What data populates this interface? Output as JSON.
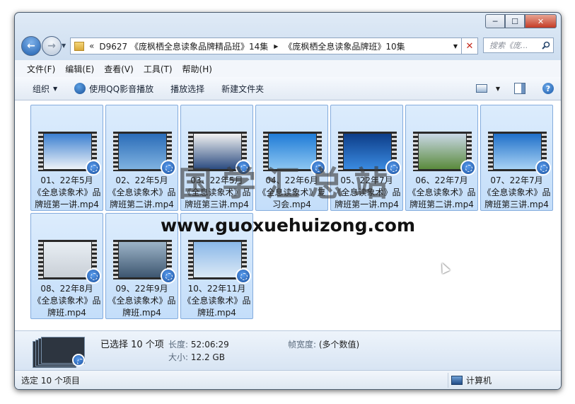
{
  "window": {
    "controls": {
      "minimize": "─",
      "maximize": "☐",
      "close": "✕"
    }
  },
  "nav": {
    "back": "←",
    "forward": "→",
    "chevron": "«",
    "path": [
      "D9627 《庞枫栖全息读象品牌精品班》14集",
      "《庞枫栖全息读象品牌班》10集"
    ],
    "search_placeholder": "搜索《庞...",
    "stop": "✕"
  },
  "menu": [
    "文件(F)",
    "编辑(E)",
    "查看(V)",
    "工具(T)",
    "帮助(H)"
  ],
  "toolbar": {
    "organize": "组织",
    "play_qq": "使用QQ影音播放",
    "play_selection": "播放选择",
    "new_folder": "新建文件夹",
    "help": "?"
  },
  "files": [
    {
      "name": "01、22年5月《全息读象术》品牌班第一讲.mp4",
      "colors": [
        "#3b7fd0",
        "#eef3f8"
      ]
    },
    {
      "name": "02、22年5月《全息读象术》品牌班第二讲.mp4",
      "colors": [
        "#2a6cb8",
        "#7fb2e0"
      ]
    },
    {
      "name": "03、22年5月《全息读象术》品牌班第三讲.mp4",
      "colors": [
        "#f2f2f2",
        "#2b4b80"
      ]
    },
    {
      "name": "04、22年6月《全息读象术》复习会.mp4",
      "colors": [
        "#1f7bd6",
        "#8cc6f2"
      ]
    },
    {
      "name": "05、22年7月《全息读象术》品牌班第一讲.mp4",
      "colors": [
        "#0d3d88",
        "#3a8ae0"
      ]
    },
    {
      "name": "06、22年7月《全息读象术》品牌班第二讲.mp4",
      "colors": [
        "#c9d8e6",
        "#5a8a3c"
      ]
    },
    {
      "name": "07、22年7月《全息读象术》品牌班第三讲.mp4",
      "colors": [
        "#1f6fc9",
        "#a8d2f4"
      ]
    },
    {
      "name": "08、22年8月《全息读象术》品牌班.mp4",
      "colors": [
        "#e8eef4",
        "#c9cfd6"
      ]
    },
    {
      "name": "09、22年9月《全息读象术》品牌班.mp4",
      "colors": [
        "#9db4c8",
        "#3d5670"
      ]
    },
    {
      "name": "10、22年11月《全息读象术》品牌班.mp4",
      "colors": [
        "#8ab8e8",
        "#dbe9f6"
      ]
    }
  ],
  "watermark": {
    "cn": "国学汇总站",
    "url": "www.guoxuehuizong.com"
  },
  "details": {
    "selected": "已选择 10 个项",
    "length_label": "长度:",
    "length": "52:06:29",
    "size_label": "大小:",
    "size": "12.2 GB",
    "frame_width_label": "帧宽度:",
    "frame_width": "(多个数值)"
  },
  "status": {
    "left": "选定 10 个项目",
    "right": "计算机"
  }
}
